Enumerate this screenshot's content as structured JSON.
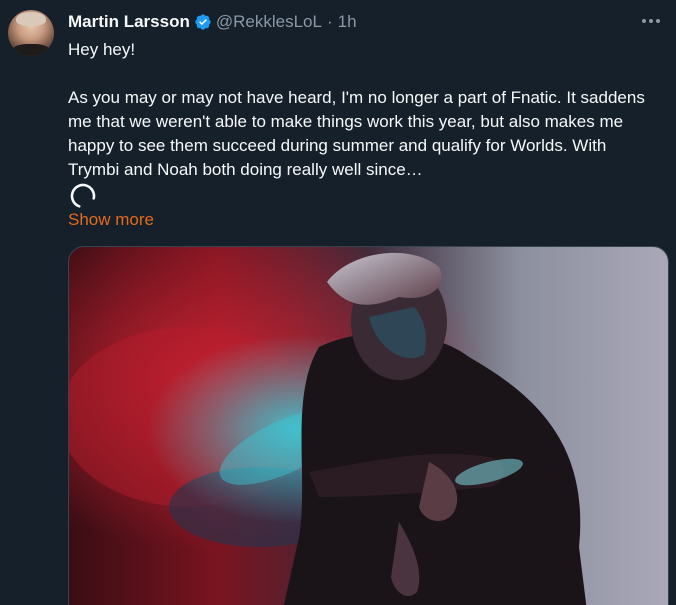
{
  "tweet": {
    "author_name": "Martin Larsson",
    "handle": "@RekklesLoL",
    "separator": "·",
    "time": "1h",
    "greeting": "Hey hey!",
    "body": "As you may or may not have heard, I'm no longer a part of Fnatic. It saddens me that we weren't able to make things work this year, but also makes me happy to see them succeed during summer and qualify for Worlds. With Trymbi and Noah both doing really well since…",
    "show_more_label": "Show more"
  },
  "icons": {
    "verified": "verified-badge-icon",
    "more": "more-options-icon",
    "loading": "loading-spinner-icon"
  },
  "colors": {
    "background": "#15202b",
    "text": "#f7f9f9",
    "secondary_text": "#8b98a5",
    "verified_blue": "#1d9bf0",
    "show_more": "#e36a1b",
    "border": "#38444d"
  }
}
